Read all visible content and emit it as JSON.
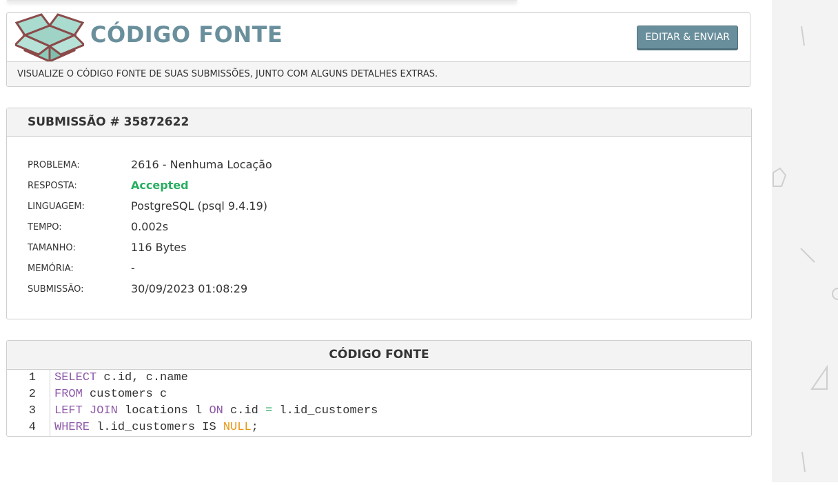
{
  "header": {
    "title": "CÓDIGO FONTE",
    "edit_button": "EDITAR & ENVIAR",
    "description": "VISUALIZE O CÓDIGO FONTE DE SUAS SUBMISSÕES, JUNTO COM ALGUNS DETALHES EXTRAS.",
    "logo_icon": "open-box-icon"
  },
  "submission": {
    "title": "SUBMISSÃO # 35872622",
    "rows": [
      {
        "label": "PROBLEMA:",
        "value": "2616 - Nenhuma Locação"
      },
      {
        "label": "RESPOSTA:",
        "value": "Accepted"
      },
      {
        "label": "LINGUAGEM:",
        "value": "PostgreSQL (psql 9.4.19)"
      },
      {
        "label": "TEMPO:",
        "value": "0.002s"
      },
      {
        "label": "TAMANHO:",
        "value": "116 Bytes"
      },
      {
        "label": "MEMÓRIA:",
        "value": "-"
      },
      {
        "label": "SUBMISSÃO:",
        "value": "30/09/2023 01:08:29"
      }
    ]
  },
  "code": {
    "title": "CÓDIGO FONTE",
    "lines": [
      {
        "number": "1",
        "text": "SELECT c.id, c.name"
      },
      {
        "number": "2",
        "text": "FROM customers c"
      },
      {
        "number": "3",
        "text": "LEFT JOIN locations l ON c.id = l.id_customers"
      },
      {
        "number": "4",
        "text": "WHERE l.id_customers IS NULL;"
      }
    ]
  },
  "colors": {
    "accent": "#6a8f9c",
    "accepted": "#27ae60",
    "keyword": "#8e58a8",
    "operator": "#27ae60",
    "null_literal": "#e8940c"
  }
}
